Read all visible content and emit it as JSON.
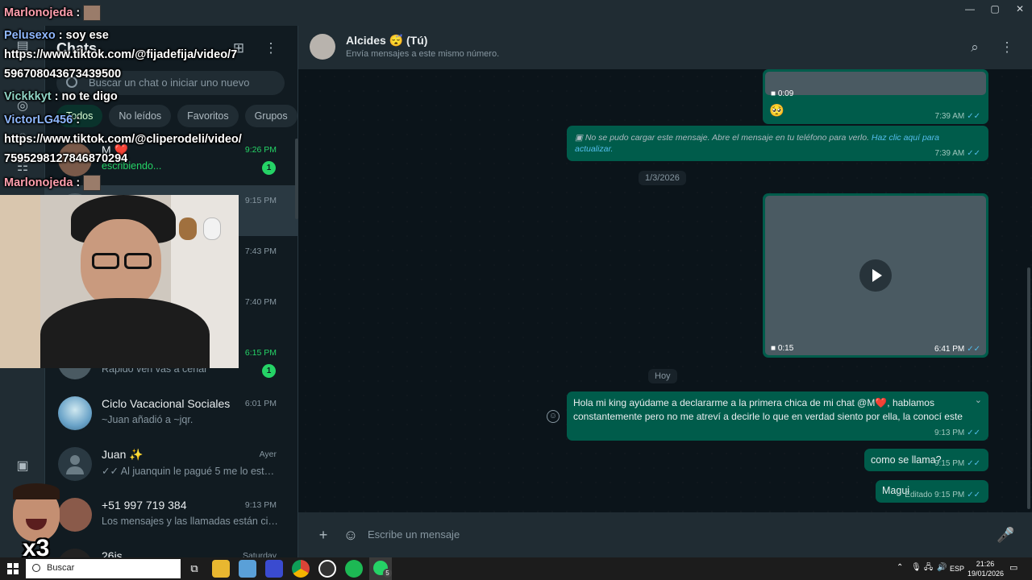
{
  "window": {
    "minimize": "—",
    "maximize": "▢",
    "close": "✕"
  },
  "chatlist": {
    "title": "Chats",
    "search_placeholder": "Buscar un chat o iniciar uno nuevo",
    "filters": [
      "Todos",
      "No leídos",
      "Favoritos",
      "Grupos"
    ],
    "rows": [
      {
        "name": "M ❤️",
        "time": "9:26 PM",
        "preview": "escribiendo...",
        "badge": "1",
        "avatar_color": "#7a5a4a"
      },
      {
        "name": "",
        "time": "9:15 PM",
        "preview": "",
        "badge": "",
        "avatar_color": "#4a5a62"
      },
      {
        "name": "",
        "time": "7:43 PM",
        "preview": "",
        "badge": "",
        "avatar_color": "#4a5a62"
      },
      {
        "name": "",
        "time": "7:40 PM",
        "preview": "",
        "badge": "",
        "avatar_color": "#4a5a62"
      },
      {
        "name": "",
        "time": "6:15 PM",
        "preview": "Rapido ven vas a cenar",
        "badge": "1",
        "avatar_color": "#4a5a62"
      },
      {
        "name": "Ciclo Vacacional Sociales",
        "time": "6:01 PM",
        "preview": "~Juan añadió a ~jqr.",
        "badge": "",
        "avatar_color": "#6aa3c8"
      },
      {
        "name": "Juan ✨",
        "time": "Ayer",
        "preview": "✓✓ Al juanquin le pagué 5 me lo está h...",
        "badge": "",
        "avatar_color": "#6b7c85"
      },
      {
        "name": "+51 997 719 384",
        "time": "9:13 PM",
        "preview": "Los mensajes y las llamadas están cifr...",
        "badge": "",
        "avatar_color": "#8a5a4a"
      },
      {
        "name": "26is",
        "time": "Saturday",
        "preview": "",
        "badge": "",
        "avatar_color": "#222"
      }
    ]
  },
  "conversation": {
    "name": "Alcides 😴 (Tú)",
    "subtitle": "Envía mensajes a este mismo número.",
    "messages": {
      "video1_duration": "0:09",
      "emoji_msg": "🥺",
      "emoji_time": "7:39 AM",
      "failed_text": "No se pudo cargar este mensaje. Abre el mensaje en tu teléfono para verlo.",
      "failed_link": "Haz clic aquí para actualizar.",
      "failed_time": "7:39 AM",
      "date1": "1/3/2026",
      "video2_duration": "0:15",
      "video2_time": "6:41 PM",
      "date2": "Hoy",
      "long_text": "Hola mi king ayúdame a declararme a la primera chica de mi chat @M❤️, hablamos constantemente pero no me atreví a decirle lo que en verdad siento por ella, la conocí este año, con ella ya pasó de todo pero seguimos siendo amigos",
      "long_time": "9:13 PM",
      "q_text": "como se llama?",
      "q_time": "9:15 PM",
      "a_text": "Magui",
      "a_edited": "Editado",
      "a_time": "9:15 PM"
    },
    "composer_placeholder": "Escribe un mensaje"
  },
  "overlay": {
    "lines": [
      {
        "user": "Marlonojeda",
        "sep": " :",
        "text": ""
      },
      {
        "user": "Pelusexo",
        "sep": " :",
        "text": " soy ese"
      },
      {
        "user": "",
        "sep": "",
        "text": "https://www.tiktok.com/@fijadefija/video/7"
      },
      {
        "user": "",
        "sep": "",
        "text": "596708043673439500"
      },
      {
        "user": "Vickkkyt",
        "sep": " :",
        "text": " no te digo"
      },
      {
        "user": "VictorLG456",
        "sep": " :",
        "text": ""
      },
      {
        "user": "",
        "sep": "",
        "text": "https://www.tiktok.com/@cliperodeli/video/"
      },
      {
        "user": "",
        "sep": "",
        "text": "7595298127846870294"
      },
      {
        "user": "Marlonojeda",
        "sep": " :",
        "text": ""
      }
    ],
    "reaction_label": "x3"
  },
  "taskbar": {
    "search": "Buscar",
    "lang": "ESP",
    "time": "21:26",
    "date": "19/01/2026",
    "whatsapp_badge": "5"
  }
}
